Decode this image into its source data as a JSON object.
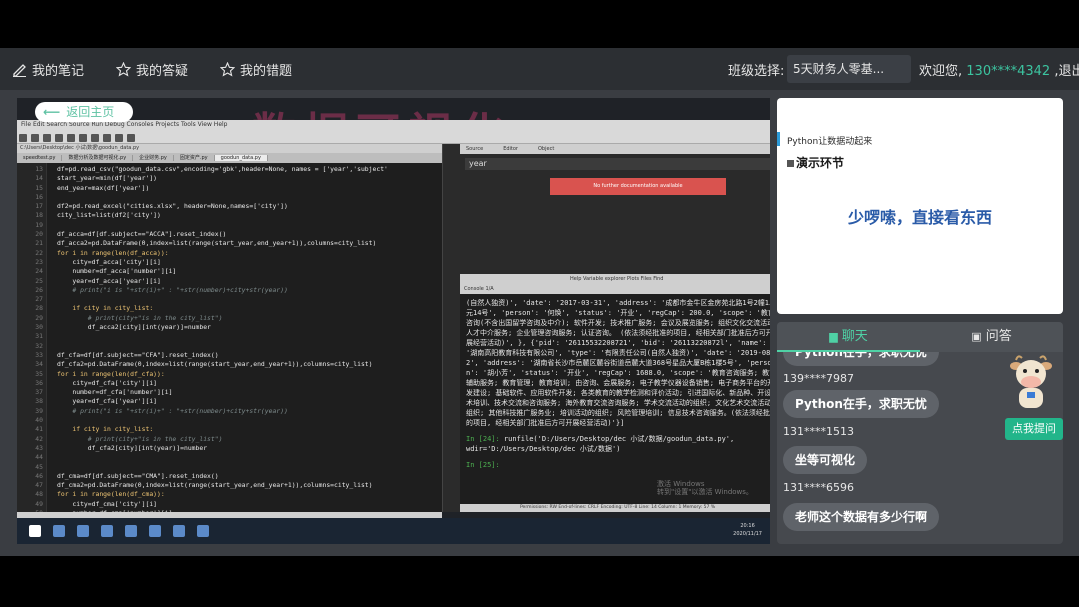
{
  "topbar": {
    "notes": "我的笔记",
    "qa": "我的答疑",
    "mistakes": "我的错题",
    "class_label": "班级选择:",
    "class_value": "5天财务人零基...",
    "welcome": "欢迎您,",
    "user": "130****4342",
    "logout": ",退出"
  },
  "video": {
    "back": "返回主页",
    "menubar": "File  Edit  Search  Source  Run  Debug  Consoles  Projects  Tools  View  Help",
    "path": "C:\\Users\\Desktop\\dec 小试\\数据\\goodun_data.py",
    "tabs": [
      "speedtest.py",
      "数据分析及数据可视化.py",
      "企业财务.py",
      "固定资产.py",
      "goodun_data.py"
    ],
    "code": [
      {
        "n": "13",
        "t": "df=pd.read_csv(\"goodun_data.csv\",encoding='gbk',header=None, names = ['year','subject'",
        "c": ""
      },
      {
        "n": "14",
        "t": "start_year=min(df['year'])",
        "c": ""
      },
      {
        "n": "15",
        "t": "end_year=max(df['year'])",
        "c": ""
      },
      {
        "n": "16",
        "t": "",
        "c": ""
      },
      {
        "n": "17",
        "t": "df2=pd.read_excel(\"cities.xlsx\", header=None,names=['city'])",
        "c": ""
      },
      {
        "n": "18",
        "t": "city_list=list(df2['city'])",
        "c": ""
      },
      {
        "n": "19",
        "t": "",
        "c": ""
      },
      {
        "n": "20",
        "t": "df_acca=df[df.subject==\"ACCA\"].reset_index()",
        "c": ""
      },
      {
        "n": "21",
        "t": "df_acca2=pd.DataFrame(0,index=list(range(start_year,end_year+1)),columns=city_list)",
        "c": ""
      },
      {
        "n": "22",
        "t": "for i in range(len(df_acca)):",
        "c": "kw"
      },
      {
        "n": "23",
        "t": "    city=df_acca['city'][i]",
        "c": ""
      },
      {
        "n": "24",
        "t": "    number=df_acca['number'][i]",
        "c": ""
      },
      {
        "n": "25",
        "t": "    year=df_acca['year'][i]",
        "c": ""
      },
      {
        "n": "26",
        "t": "    # print(\"i is \"+str(i)+\" : \"+str(number)+city+str(year))",
        "c": "comment"
      },
      {
        "n": "27",
        "t": "",
        "c": ""
      },
      {
        "n": "28",
        "t": "    if city in city_list:",
        "c": "kw"
      },
      {
        "n": "29",
        "t": "        # print(city+\"is in the city_list\")",
        "c": "comment"
      },
      {
        "n": "30",
        "t": "        df_acca2[city][int(year)]=number",
        "c": ""
      },
      {
        "n": "31",
        "t": "",
        "c": ""
      },
      {
        "n": "32",
        "t": "",
        "c": ""
      },
      {
        "n": "33",
        "t": "df_cfa=df[df.subject==\"CFA\"].reset_index()",
        "c": ""
      },
      {
        "n": "34",
        "t": "df_cfa2=pd.DataFrame(0,index=list(range(start_year,end_year+1)),columns=city_list)",
        "c": ""
      },
      {
        "n": "35",
        "t": "for i in range(len(df_cfa)):",
        "c": "kw"
      },
      {
        "n": "36",
        "t": "    city=df_cfa['city'][i]",
        "c": ""
      },
      {
        "n": "37",
        "t": "    number=df_cfa['number'][i]",
        "c": ""
      },
      {
        "n": "38",
        "t": "    year=df_cfa['year'][i]",
        "c": ""
      },
      {
        "n": "39",
        "t": "    # print(\"i is \"+str(i)+\" : \"+str(number)+city+str(year))",
        "c": "comment"
      },
      {
        "n": "40",
        "t": "",
        "c": ""
      },
      {
        "n": "41",
        "t": "    if city in city_list:",
        "c": "kw"
      },
      {
        "n": "42",
        "t": "        # print(city+\"is in the city_list\")",
        "c": "comment"
      },
      {
        "n": "43",
        "t": "        df_cfa2[city][int(year)]=number",
        "c": ""
      },
      {
        "n": "44",
        "t": "",
        "c": ""
      },
      {
        "n": "45",
        "t": "",
        "c": ""
      },
      {
        "n": "46",
        "t": "df_cma=df[df.subject==\"CMA\"].reset_index()",
        "c": ""
      },
      {
        "n": "47",
        "t": "df_cma2=pd.DataFrame(0,index=list(range(start_year,end_year+1)),columns=city_list)",
        "c": ""
      },
      {
        "n": "48",
        "t": "for i in range(len(df_cma)):",
        "c": "kw"
      },
      {
        "n": "49",
        "t": "    city=df_cma['city'][i]",
        "c": ""
      },
      {
        "n": "50",
        "t": "    number=df_cma['number'][i]",
        "c": ""
      },
      {
        "n": "51",
        "t": "    year=df_cma['year'][i]",
        "c": ""
      }
    ],
    "help_tabs": [
      "Source",
      "Editor",
      "Object"
    ],
    "year_field": "year",
    "error_text": "No further documentation available",
    "bottom_tabs": "Help  Variable explorer  Plots  Files  Find",
    "console_tab": "Console 1/A",
    "console_text": "(自然人独资)', 'date': '2017-03-31', 'address': '成都市金牛区金房苑北路1号2幢1单元14号', 'person': '何焕', 'status': '开业', 'regCap': 200.0, 'scope': '教育咨询(不含出国留学咨询及中介); 软件开发; 技术推广服务; 会议及展览服务; 组织文化交流活动; 人才中介服务; 企业管理咨询服务; 认证咨询。 (依法须经批准的项目, 经相关部门批准后方可开展经营活动)', }, {'pid': '26115532208721', 'bid': '26113220872l', 'name': '湖南高阳教育科技有限公司', 'type': '有限责任公司(自然人独资)', 'date': '2019-08-22', 'address': '湖南省长沙市岳麓区麓谷街道岳麓大道368号星品大厦B栋1楼5号', 'person': '胡小芳', 'status': '开业', 'regCap': 1688.0, 'scope': '教育咨询服务; 教育辅助服务; 教育管理; 教育培训; 由咨询、会展服务; 电子教学仪器设备销售; 电子商务平台的开发建设; 基础软件、应用软件开发; 各类教育的教学检测和评价活动; 引进国际化、新品种、开设技术培训、技术交流和咨询服务; 海外教育交流咨询服务; 学术交流活动的组织; 文化艺术交流活动的组织; 其他科技推广服务业; 培训活动的组织; 风险管理培训; 信息技术咨询服务。(依法须经批准的项目, 经相关部门批准后方可开展经营活动)'}]",
    "console_in1": "In [24]:",
    "console_cmd": " runfile('D:/Users/Desktop/dec 小试/数据/goodun_data.py', wdir='D:/Users/Desktop/dec 小试/数据')",
    "console_in2": "In [25]:",
    "watermark": "激活 Windows\n转到\"设置\"以激活 Windows。",
    "status": "Permissions: RW   End-of-lines: CRLF   Encoding: UTF-8   Line: 14   Column: 1   Memory: 57 %",
    "tray_time": "20:16",
    "tray_date": "2020/11/17",
    "overlay": "数据可视化"
  },
  "slide": {
    "small_title": "Python让数据动起来",
    "section": "演示环节",
    "main": "少啰嗦，直接看东西"
  },
  "chat": {
    "tab_chat": "聊天",
    "tab_qa": "问答",
    "messages": [
      {
        "user": "",
        "text": "Python在手，求职无忧"
      },
      {
        "user": "139****7987",
        "text": "Python在手，求职无忧"
      },
      {
        "user": "131****1513",
        "text": "坐等可视化"
      },
      {
        "user": "131****6596",
        "text": "老师这个数据有多少行啊"
      }
    ],
    "ask_button": "点我提问"
  }
}
